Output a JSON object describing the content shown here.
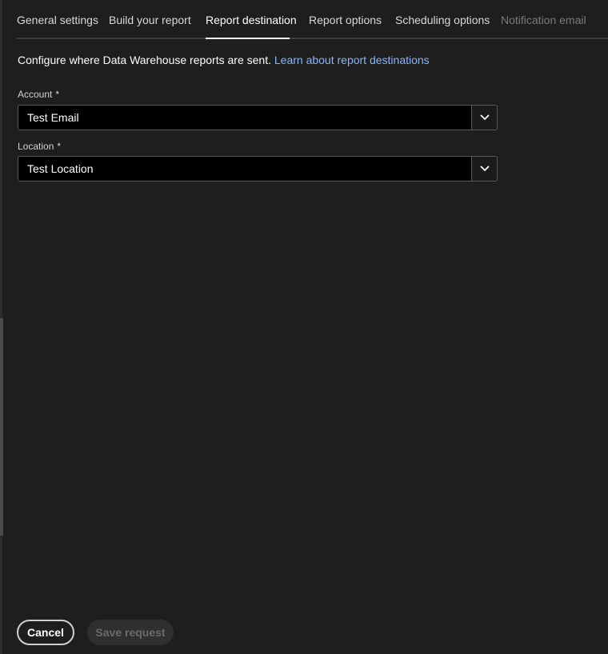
{
  "tabs": [
    {
      "label": "General settings",
      "state": "normal"
    },
    {
      "label": "Build your report",
      "state": "normal"
    },
    {
      "label": "Report destination",
      "state": "active"
    },
    {
      "label": "Report options",
      "state": "normal"
    },
    {
      "label": "Scheduling options",
      "state": "normal"
    },
    {
      "label": "Notification email",
      "state": "disabled"
    }
  ],
  "description": {
    "text": "Configure where Data Warehouse reports are sent.",
    "link": "Learn about report destinations"
  },
  "account": {
    "label": "Account",
    "required_marker": "*",
    "value": "Test Email",
    "icon": "chevron-down-icon"
  },
  "location": {
    "label": "Location",
    "required_marker": "*",
    "value": "Test Location",
    "icon": "chevron-down-icon"
  },
  "footer": {
    "cancel_label": "Cancel",
    "save_label": "Save request"
  },
  "colors": {
    "background": "#1e1e1e",
    "link": "#86b6ff",
    "field_background": "#000000",
    "disabled_text": "#6b6b6b"
  }
}
